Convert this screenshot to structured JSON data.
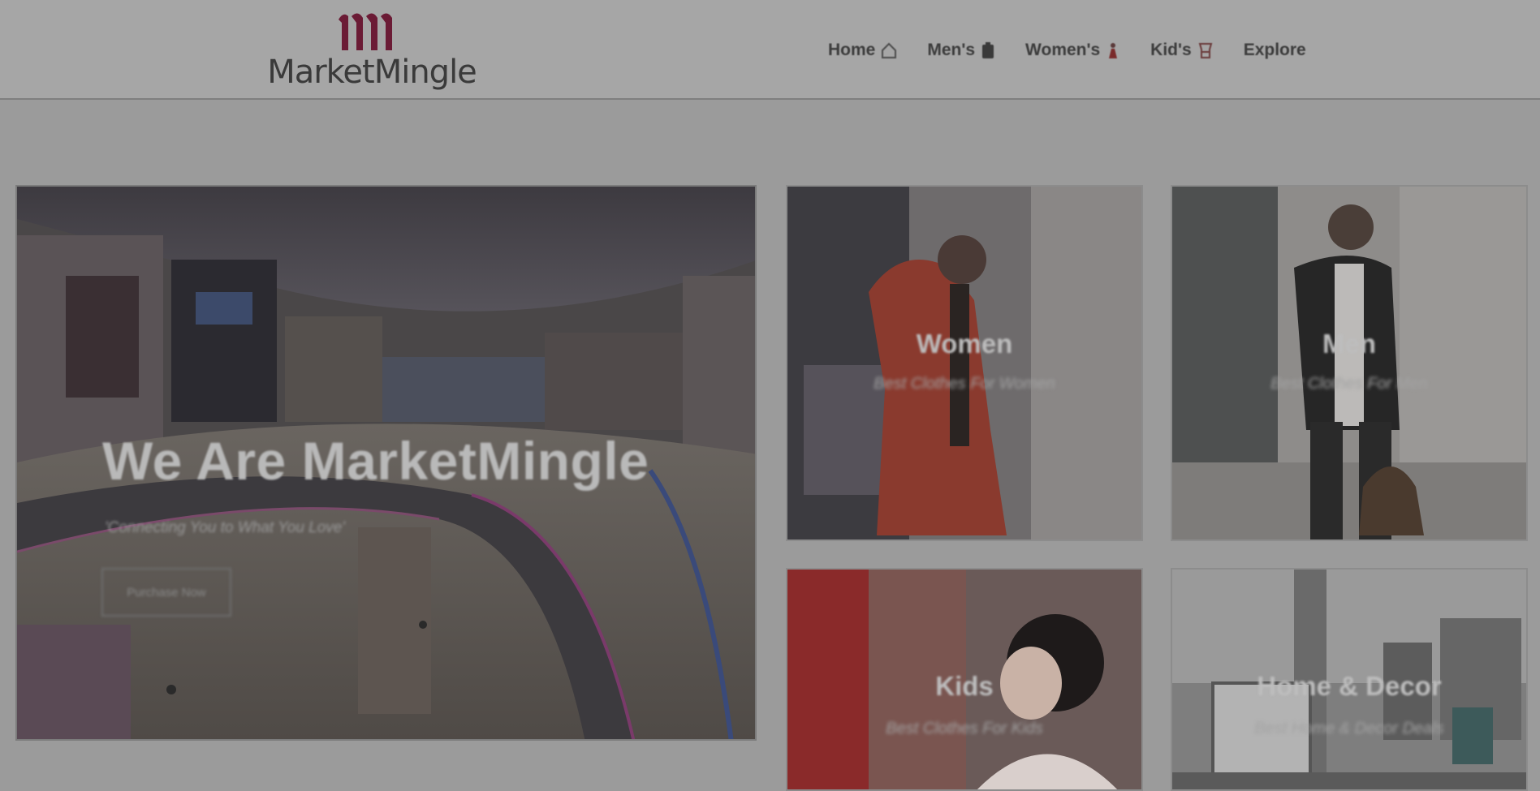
{
  "brand": {
    "name": "MarketMingle",
    "color": "#7a1f3d"
  },
  "nav": [
    {
      "label": "Home",
      "icon": "house-icon"
    },
    {
      "label": "Men's",
      "icon": "shirt-icon"
    },
    {
      "label": "Women's",
      "icon": "dress-icon"
    },
    {
      "label": "Kid's",
      "icon": "kids-clothing-icon"
    },
    {
      "label": "Explore",
      "icon": ""
    }
  ],
  "hero": {
    "title": "We Are MarketMingle",
    "subtitle": "'Connecting You to What You Love'",
    "button": "Purchase Now"
  },
  "cards": [
    {
      "title": "Women",
      "subtitle": "Best Clothes For Women"
    },
    {
      "title": "Men",
      "subtitle": "Best Clothes For Men"
    },
    {
      "title": "Kids",
      "subtitle": "Best Clothes For Kids"
    },
    {
      "title": "Home & Decor",
      "subtitle": "Best Home & Decor Deals"
    }
  ]
}
